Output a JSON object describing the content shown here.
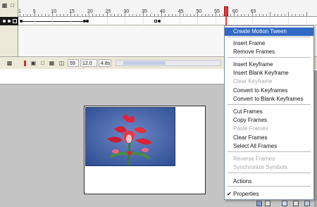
{
  "timeline": {
    "ruler_labels": [
      "1",
      "5",
      "10",
      "15",
      "20",
      "25",
      "30",
      "35",
      "40",
      "45",
      "50",
      "55",
      "60",
      "65"
    ],
    "status": {
      "current_frame": "59",
      "frame_rate": "12.0 fps",
      "elapsed": "4.8s"
    }
  },
  "context_menu": {
    "items": [
      {
        "label": "Create Motion Tween",
        "state": "highlighted"
      },
      {
        "label": "Insert Frame",
        "state": "enabled"
      },
      {
        "label": "Remove Frames",
        "state": "enabled"
      },
      {
        "label": "Insert Keyframe",
        "state": "enabled"
      },
      {
        "label": "Insert Blank Keyframe",
        "state": "enabled"
      },
      {
        "label": "Clear Keyframe",
        "state": "disabled"
      },
      {
        "label": "Convert to Keyframes",
        "state": "enabled"
      },
      {
        "label": "Convert to Blank Keyframes",
        "state": "enabled"
      },
      {
        "label": "Cut Frames",
        "state": "enabled"
      },
      {
        "label": "Copy Frames",
        "state": "enabled"
      },
      {
        "label": "Paste Frames",
        "state": "disabled"
      },
      {
        "label": "Clear Frames",
        "state": "enabled"
      },
      {
        "label": "Select All Frames",
        "state": "enabled"
      },
      {
        "label": "Reverse Frames",
        "state": "disabled"
      },
      {
        "label": "Synchronize Symbols",
        "state": "disabled"
      },
      {
        "label": "Actions",
        "state": "enabled"
      },
      {
        "label": "Properties",
        "state": "checked"
      }
    ]
  },
  "colors": {
    "menu_highlight": "#316ac5",
    "playhead": "#e23b3b",
    "photo_background": "#4d6aa8"
  },
  "icons": {
    "onion": "onion-skin-icon",
    "lock": "lock-icon",
    "trash": "trash-icon"
  }
}
